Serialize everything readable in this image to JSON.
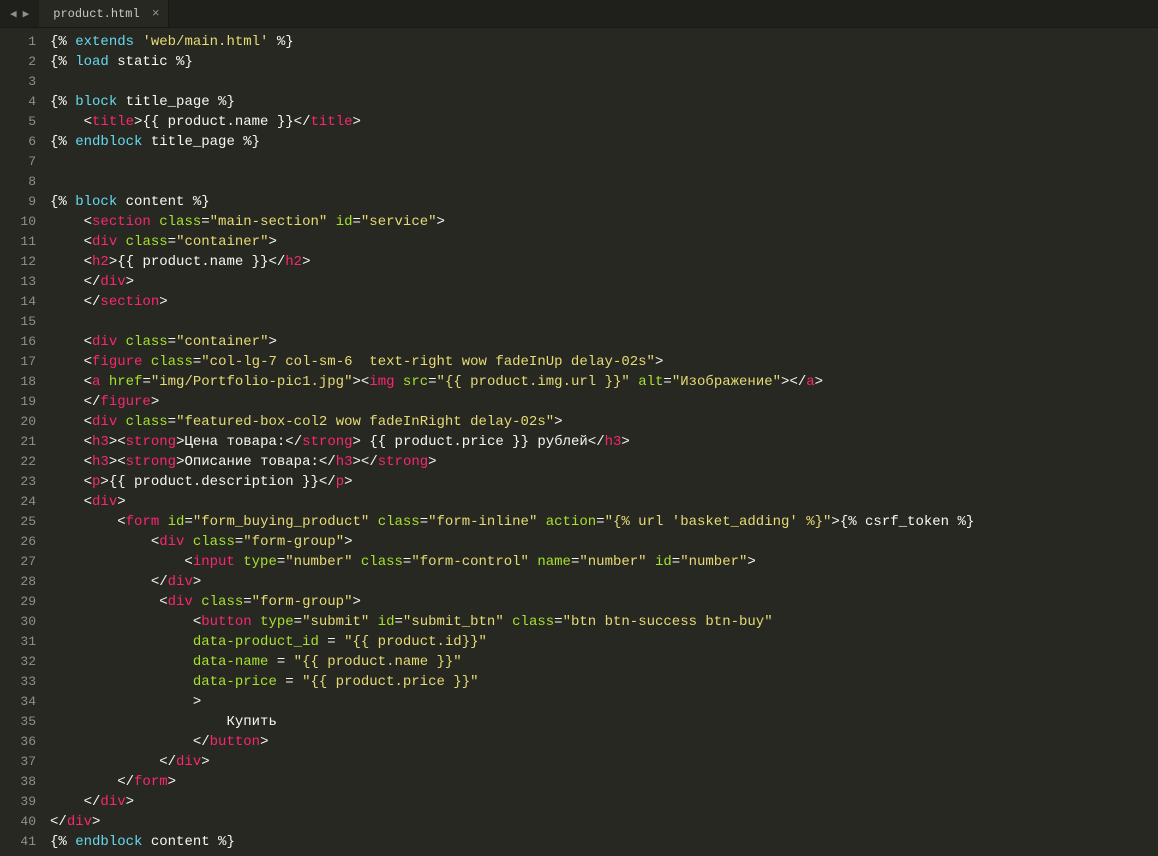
{
  "tab": {
    "filename": "product.html",
    "close": "×"
  },
  "nav": {
    "left": "◀",
    "right": "▶"
  },
  "lines": [
    {
      "n": 1,
      "indent": "",
      "tokens": [
        [
          "tmpl",
          "{% "
        ],
        [
          "kw",
          "extends"
        ],
        [
          "tmpl",
          " "
        ],
        [
          "str",
          "'web/main.html'"
        ],
        [
          "tmpl",
          " %}"
        ]
      ]
    },
    {
      "n": 2,
      "indent": "",
      "tokens": [
        [
          "tmpl",
          "{% "
        ],
        [
          "kw",
          "load"
        ],
        [
          "tmpl",
          " static %}"
        ]
      ]
    },
    {
      "n": 3,
      "indent": "",
      "tokens": []
    },
    {
      "n": 4,
      "indent": "",
      "tokens": [
        [
          "tmpl",
          "{% "
        ],
        [
          "kw",
          "block"
        ],
        [
          "tmpl",
          " title_page %}"
        ]
      ]
    },
    {
      "n": 5,
      "indent": "    ",
      "tokens": [
        [
          "punc",
          "<"
        ],
        [
          "tag",
          "title"
        ],
        [
          "punc",
          ">"
        ],
        [
          "tmpl",
          "{{ product.name }}"
        ],
        [
          "punc",
          "</"
        ],
        [
          "tag",
          "title"
        ],
        [
          "punc",
          ">"
        ]
      ]
    },
    {
      "n": 6,
      "indent": "",
      "tokens": [
        [
          "tmpl",
          "{% "
        ],
        [
          "kw",
          "endblock"
        ],
        [
          "tmpl",
          " title_page %}"
        ]
      ]
    },
    {
      "n": 7,
      "indent": "",
      "tokens": []
    },
    {
      "n": 8,
      "indent": "",
      "tokens": []
    },
    {
      "n": 9,
      "indent": "",
      "tokens": [
        [
          "tmpl",
          "{% "
        ],
        [
          "kw",
          "block"
        ],
        [
          "tmpl",
          " content %}"
        ]
      ]
    },
    {
      "n": 10,
      "indent": "    ",
      "tokens": [
        [
          "punc",
          "<"
        ],
        [
          "tag",
          "section"
        ],
        [
          "txt",
          " "
        ],
        [
          "attr",
          "class"
        ],
        [
          "punc",
          "="
        ],
        [
          "str",
          "\"main-section\""
        ],
        [
          "txt",
          " "
        ],
        [
          "attr",
          "id"
        ],
        [
          "punc",
          "="
        ],
        [
          "str",
          "\"service\""
        ],
        [
          "punc",
          ">"
        ]
      ]
    },
    {
      "n": 11,
      "indent": "    ",
      "tokens": [
        [
          "punc",
          "<"
        ],
        [
          "tag",
          "div"
        ],
        [
          "txt",
          " "
        ],
        [
          "attr",
          "class"
        ],
        [
          "punc",
          "="
        ],
        [
          "str",
          "\"container\""
        ],
        [
          "punc",
          ">"
        ]
      ]
    },
    {
      "n": 12,
      "indent": "    ",
      "tokens": [
        [
          "punc",
          "<"
        ],
        [
          "tag",
          "h2"
        ],
        [
          "punc",
          ">"
        ],
        [
          "tmpl",
          "{{ product.name }}"
        ],
        [
          "punc",
          "</"
        ],
        [
          "tag",
          "h2"
        ],
        [
          "punc",
          ">"
        ]
      ]
    },
    {
      "n": 13,
      "indent": "    ",
      "tokens": [
        [
          "punc",
          "</"
        ],
        [
          "tag",
          "div"
        ],
        [
          "punc",
          ">"
        ]
      ]
    },
    {
      "n": 14,
      "indent": "    ",
      "tokens": [
        [
          "punc",
          "</"
        ],
        [
          "tag",
          "section"
        ],
        [
          "punc",
          ">"
        ]
      ]
    },
    {
      "n": 15,
      "indent": "",
      "tokens": []
    },
    {
      "n": 16,
      "indent": "    ",
      "tokens": [
        [
          "punc",
          "<"
        ],
        [
          "tag",
          "div"
        ],
        [
          "txt",
          " "
        ],
        [
          "attr",
          "class"
        ],
        [
          "punc",
          "="
        ],
        [
          "str",
          "\"container\""
        ],
        [
          "punc",
          ">"
        ]
      ]
    },
    {
      "n": 17,
      "indent": "    ",
      "tokens": [
        [
          "punc",
          "<"
        ],
        [
          "tag",
          "figure"
        ],
        [
          "txt",
          " "
        ],
        [
          "attr",
          "class"
        ],
        [
          "punc",
          "="
        ],
        [
          "str",
          "\"col-lg-7 col-sm-6  text-right wow fadeInUp delay-02s\""
        ],
        [
          "punc",
          ">"
        ]
      ]
    },
    {
      "n": 18,
      "indent": "    ",
      "tokens": [
        [
          "punc",
          "<"
        ],
        [
          "tag",
          "a"
        ],
        [
          "txt",
          " "
        ],
        [
          "attr",
          "href"
        ],
        [
          "punc",
          "="
        ],
        [
          "str",
          "\"img/Portfolio-pic1.jpg\""
        ],
        [
          "punc",
          ">"
        ],
        [
          "punc",
          "<"
        ],
        [
          "tag",
          "img"
        ],
        [
          "txt",
          " "
        ],
        [
          "attr",
          "src"
        ],
        [
          "punc",
          "="
        ],
        [
          "str",
          "\"{{ product.img.url }}\""
        ],
        [
          "txt",
          " "
        ],
        [
          "attr",
          "alt"
        ],
        [
          "punc",
          "="
        ],
        [
          "str",
          "\"Изображение\""
        ],
        [
          "punc",
          ">"
        ],
        [
          "punc",
          "</"
        ],
        [
          "tag",
          "a"
        ],
        [
          "punc",
          ">"
        ]
      ]
    },
    {
      "n": 19,
      "indent": "    ",
      "tokens": [
        [
          "punc",
          "</"
        ],
        [
          "tag",
          "figure"
        ],
        [
          "punc",
          ">"
        ]
      ]
    },
    {
      "n": 20,
      "indent": "    ",
      "tokens": [
        [
          "punc",
          "<"
        ],
        [
          "tag",
          "div"
        ],
        [
          "txt",
          " "
        ],
        [
          "attr",
          "class"
        ],
        [
          "punc",
          "="
        ],
        [
          "str",
          "\"featured-box-col2 wow fadeInRight delay-02s\""
        ],
        [
          "punc",
          ">"
        ]
      ]
    },
    {
      "n": 21,
      "indent": "    ",
      "tokens": [
        [
          "punc",
          "<"
        ],
        [
          "tag",
          "h3"
        ],
        [
          "punc",
          ">"
        ],
        [
          "punc",
          "<"
        ],
        [
          "tag",
          "strong"
        ],
        [
          "punc",
          ">"
        ],
        [
          "txt",
          "Цена товара:"
        ],
        [
          "punc",
          "</"
        ],
        [
          "tag",
          "strong"
        ],
        [
          "punc",
          ">"
        ],
        [
          "txt",
          " "
        ],
        [
          "tmpl",
          "{{ product.price }}"
        ],
        [
          "txt",
          " рублей"
        ],
        [
          "punc",
          "</"
        ],
        [
          "tag",
          "h3"
        ],
        [
          "punc",
          ">"
        ]
      ]
    },
    {
      "n": 22,
      "indent": "    ",
      "tokens": [
        [
          "punc",
          "<"
        ],
        [
          "tag",
          "h3"
        ],
        [
          "punc",
          ">"
        ],
        [
          "punc",
          "<"
        ],
        [
          "tag",
          "strong"
        ],
        [
          "punc",
          ">"
        ],
        [
          "txt",
          "Описание товара:"
        ],
        [
          "punc",
          "</"
        ],
        [
          "tag",
          "h3"
        ],
        [
          "punc",
          ">"
        ],
        [
          "punc",
          "</"
        ],
        [
          "tag",
          "strong"
        ],
        [
          "punc",
          ">"
        ]
      ]
    },
    {
      "n": 23,
      "indent": "    ",
      "tokens": [
        [
          "punc",
          "<"
        ],
        [
          "tag",
          "p"
        ],
        [
          "punc",
          ">"
        ],
        [
          "tmpl",
          "{{ product.description }}"
        ],
        [
          "punc",
          "</"
        ],
        [
          "tag",
          "p"
        ],
        [
          "punc",
          ">"
        ]
      ]
    },
    {
      "n": 24,
      "indent": "    ",
      "tokens": [
        [
          "punc",
          "<"
        ],
        [
          "tag",
          "div"
        ],
        [
          "punc",
          ">"
        ]
      ]
    },
    {
      "n": 25,
      "indent": "        ",
      "tokens": [
        [
          "punc",
          "<"
        ],
        [
          "tag",
          "form"
        ],
        [
          "txt",
          " "
        ],
        [
          "attr",
          "id"
        ],
        [
          "punc",
          "="
        ],
        [
          "str",
          "\"form_buying_product\""
        ],
        [
          "txt",
          " "
        ],
        [
          "attr",
          "class"
        ],
        [
          "punc",
          "="
        ],
        [
          "str",
          "\"form-inline\""
        ],
        [
          "txt",
          " "
        ],
        [
          "attr",
          "action"
        ],
        [
          "punc",
          "="
        ],
        [
          "str",
          "\"{% url 'basket_adding' %}\""
        ],
        [
          "punc",
          ">"
        ],
        [
          "tmpl",
          "{% csrf_token %}"
        ]
      ]
    },
    {
      "n": 26,
      "indent": "            ",
      "tokens": [
        [
          "punc",
          "<"
        ],
        [
          "tag",
          "div"
        ],
        [
          "txt",
          " "
        ],
        [
          "attr",
          "class"
        ],
        [
          "punc",
          "="
        ],
        [
          "str",
          "\"form-group\""
        ],
        [
          "punc",
          ">"
        ]
      ]
    },
    {
      "n": 27,
      "indent": "                ",
      "tokens": [
        [
          "punc",
          "<"
        ],
        [
          "tag",
          "input"
        ],
        [
          "txt",
          " "
        ],
        [
          "attr",
          "type"
        ],
        [
          "punc",
          "="
        ],
        [
          "str",
          "\"number\""
        ],
        [
          "txt",
          " "
        ],
        [
          "attr",
          "class"
        ],
        [
          "punc",
          "="
        ],
        [
          "str",
          "\"form-control\""
        ],
        [
          "txt",
          " "
        ],
        [
          "attr",
          "name"
        ],
        [
          "punc",
          "="
        ],
        [
          "str",
          "\"number\""
        ],
        [
          "txt",
          " "
        ],
        [
          "attr",
          "id"
        ],
        [
          "punc",
          "="
        ],
        [
          "str",
          "\"number\""
        ],
        [
          "punc",
          ">"
        ]
      ]
    },
    {
      "n": 28,
      "indent": "            ",
      "tokens": [
        [
          "punc",
          "</"
        ],
        [
          "tag",
          "div"
        ],
        [
          "punc",
          ">"
        ]
      ]
    },
    {
      "n": 29,
      "indent": "             ",
      "tokens": [
        [
          "punc",
          "<"
        ],
        [
          "tag",
          "div"
        ],
        [
          "txt",
          " "
        ],
        [
          "attr",
          "class"
        ],
        [
          "punc",
          "="
        ],
        [
          "str",
          "\"form-group\""
        ],
        [
          "punc",
          ">"
        ]
      ]
    },
    {
      "n": 30,
      "indent": "                 ",
      "tokens": [
        [
          "punc",
          "<"
        ],
        [
          "tag",
          "button"
        ],
        [
          "txt",
          " "
        ],
        [
          "attr",
          "type"
        ],
        [
          "punc",
          "="
        ],
        [
          "str",
          "\"submit\""
        ],
        [
          "txt",
          " "
        ],
        [
          "attr",
          "id"
        ],
        [
          "punc",
          "="
        ],
        [
          "str",
          "\"submit_btn\""
        ],
        [
          "txt",
          " "
        ],
        [
          "attr",
          "class"
        ],
        [
          "punc",
          "="
        ],
        [
          "str",
          "\"btn btn-success btn-buy\""
        ]
      ]
    },
    {
      "n": 31,
      "indent": "                 ",
      "tokens": [
        [
          "attr",
          "data-product_id"
        ],
        [
          "txt",
          " "
        ],
        [
          "punc",
          "="
        ],
        [
          "txt",
          " "
        ],
        [
          "str",
          "\"{{ product.id}}\""
        ]
      ]
    },
    {
      "n": 32,
      "indent": "                 ",
      "tokens": [
        [
          "attr",
          "data-name"
        ],
        [
          "txt",
          " "
        ],
        [
          "punc",
          "="
        ],
        [
          "txt",
          " "
        ],
        [
          "str",
          "\"{{ product.name }}\""
        ]
      ]
    },
    {
      "n": 33,
      "indent": "                 ",
      "tokens": [
        [
          "attr",
          "data-price"
        ],
        [
          "txt",
          " "
        ],
        [
          "punc",
          "="
        ],
        [
          "txt",
          " "
        ],
        [
          "str",
          "\"{{ product.price }}\""
        ]
      ]
    },
    {
      "n": 34,
      "indent": "                 ",
      "tokens": [
        [
          "punc",
          ">"
        ]
      ]
    },
    {
      "n": 35,
      "indent": "                     ",
      "tokens": [
        [
          "txt",
          "Купить"
        ]
      ]
    },
    {
      "n": 36,
      "indent": "                 ",
      "tokens": [
        [
          "punc",
          "</"
        ],
        [
          "tag",
          "button"
        ],
        [
          "punc",
          ">"
        ]
      ]
    },
    {
      "n": 37,
      "indent": "             ",
      "tokens": [
        [
          "punc",
          "</"
        ],
        [
          "tag",
          "div"
        ],
        [
          "punc",
          ">"
        ]
      ]
    },
    {
      "n": 38,
      "indent": "        ",
      "tokens": [
        [
          "punc",
          "</"
        ],
        [
          "tag",
          "form"
        ],
        [
          "punc",
          ">"
        ]
      ]
    },
    {
      "n": 39,
      "indent": "    ",
      "tokens": [
        [
          "punc",
          "</"
        ],
        [
          "tag",
          "div"
        ],
        [
          "punc",
          ">"
        ]
      ]
    },
    {
      "n": 40,
      "indent": "",
      "tokens": [
        [
          "punc",
          "</"
        ],
        [
          "tag",
          "div"
        ],
        [
          "punc",
          ">"
        ]
      ]
    },
    {
      "n": 41,
      "indent": "",
      "tokens": [
        [
          "tmpl",
          "{% "
        ],
        [
          "kw",
          "endblock"
        ],
        [
          "tmpl",
          " content %}"
        ]
      ]
    }
  ]
}
